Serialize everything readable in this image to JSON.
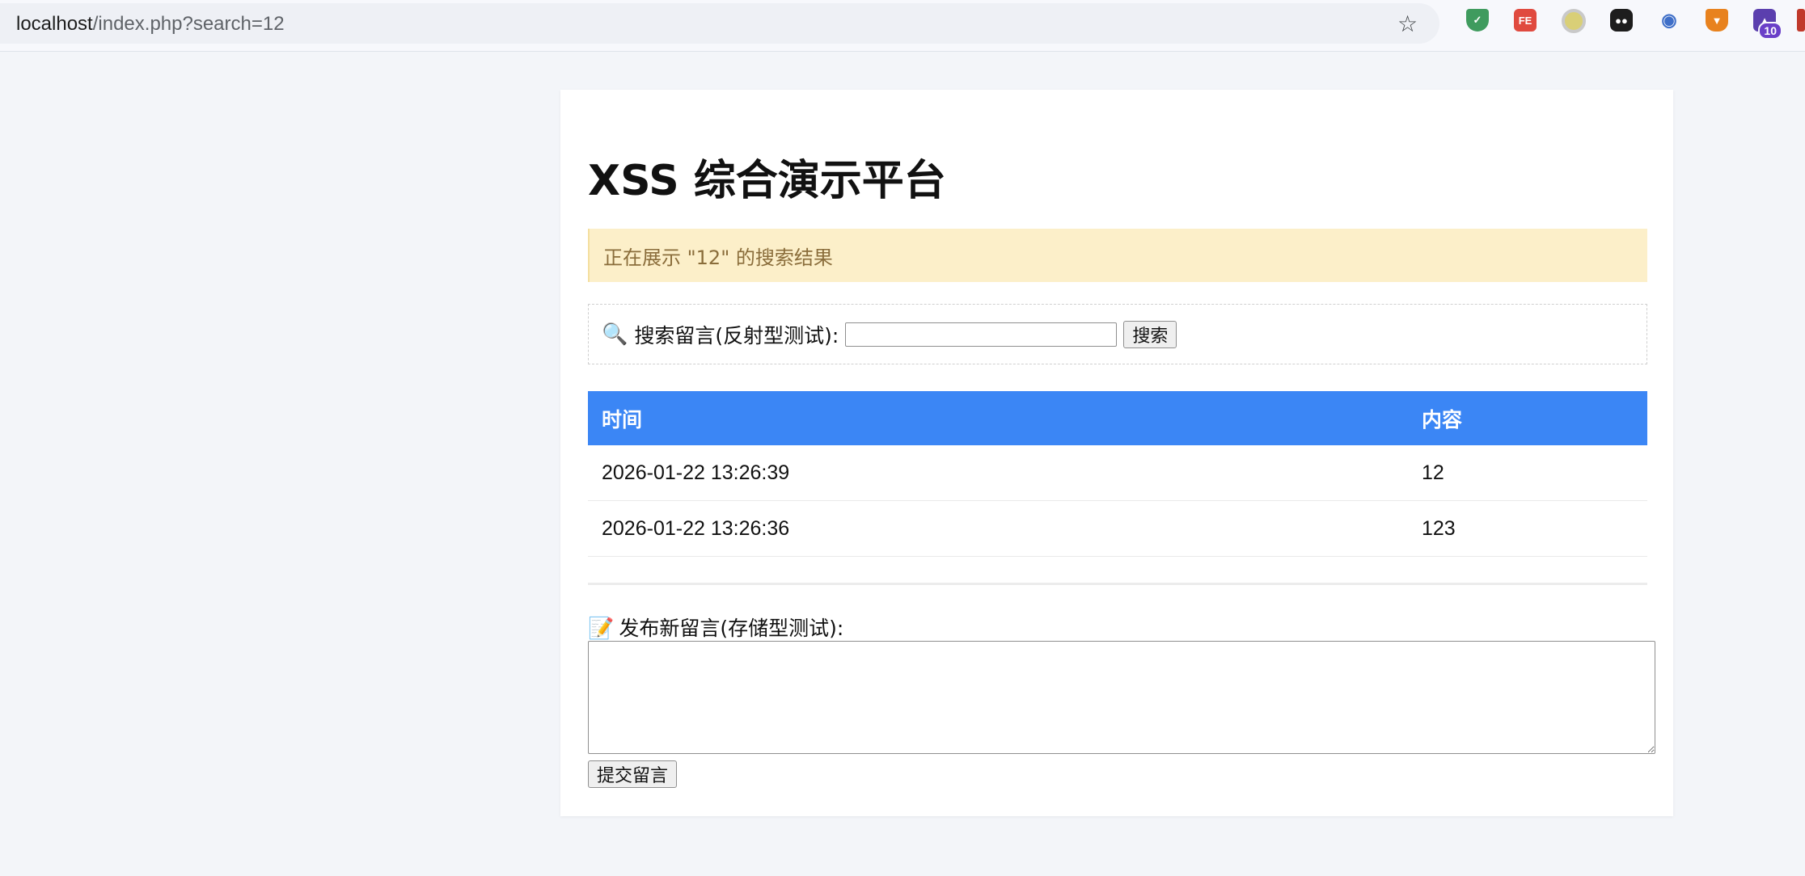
{
  "browser": {
    "url_host": "localhost",
    "url_path": "/index.php?search=12",
    "extensions": [
      {
        "icon": "shield-icon"
      },
      {
        "icon": "fe-icon",
        "label": "FE"
      },
      {
        "icon": "circle-icon"
      },
      {
        "icon": "ghost-icon"
      },
      {
        "icon": "eye-icon"
      },
      {
        "icon": "fox-icon"
      },
      {
        "icon": "cap-icon",
        "badge": "10"
      }
    ]
  },
  "page": {
    "title": "XSS 综合演示平台",
    "alert": "正在展示 \"12\" 的搜索结果",
    "search": {
      "label": "搜索留言(反射型测试):",
      "value": "",
      "button": "搜索"
    },
    "table": {
      "headers": [
        "时间",
        "内容"
      ],
      "rows": [
        {
          "time": "2026-01-22 13:26:39",
          "content": "12"
        },
        {
          "time": "2026-01-22 13:26:36",
          "content": "123"
        }
      ]
    },
    "post": {
      "label": "发布新留言(存储型测试):",
      "value": "",
      "button": "提交留言"
    }
  },
  "colors": {
    "header_bg": "#3b86f5",
    "alert_bg": "#fcefc9",
    "alert_text": "#8a6d3b",
    "page_bg": "#f3f5f9"
  }
}
